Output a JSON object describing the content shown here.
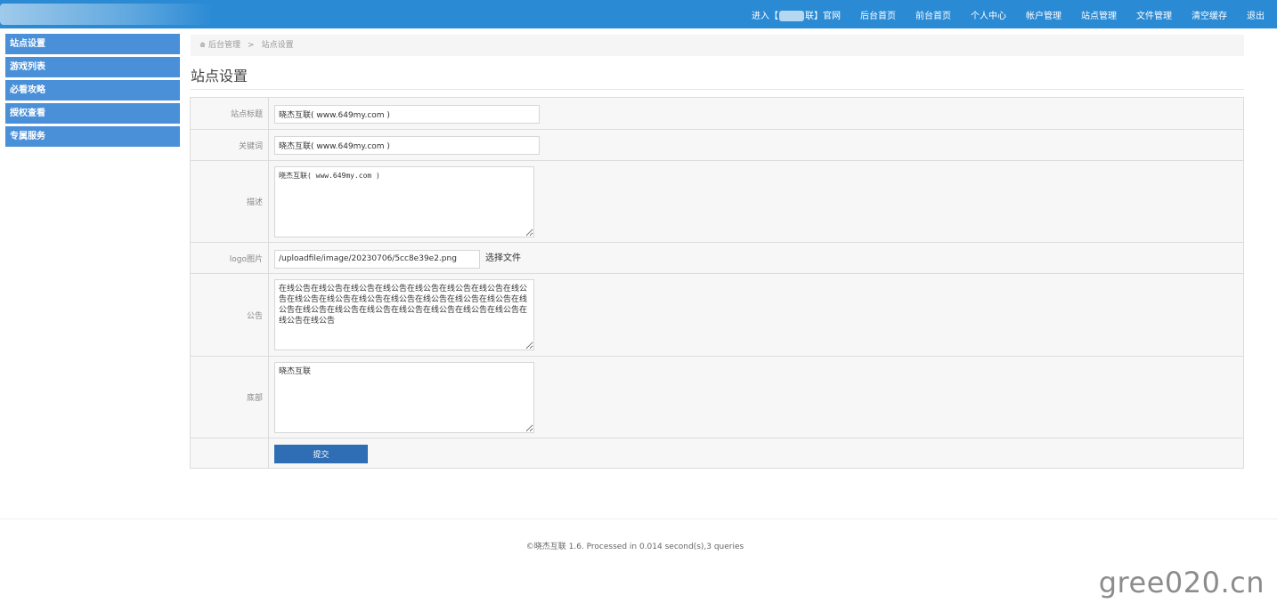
{
  "header": {
    "nav": [
      {
        "label": "进入【",
        "suffix": "联】官网"
      },
      {
        "label": "后台首页"
      },
      {
        "label": "前台首页"
      },
      {
        "label": "个人中心"
      },
      {
        "label": "帐户管理"
      },
      {
        "label": "站点管理"
      },
      {
        "label": "文件管理"
      },
      {
        "label": "清空缓存"
      },
      {
        "label": "退出"
      }
    ]
  },
  "sidebar": {
    "items": [
      {
        "label": "站点设置"
      },
      {
        "label": "游戏列表"
      },
      {
        "label": "必看攻略"
      },
      {
        "label": "授权查看"
      },
      {
        "label": "专属服务"
      }
    ]
  },
  "breadcrumb": {
    "root": "后台管理",
    "separator": ">",
    "current": "站点设置"
  },
  "page": {
    "title": "站点设置"
  },
  "form": {
    "site_title": {
      "label": "站点标题",
      "value": "晓杰互联( www.649my.com )"
    },
    "keywords": {
      "label": "关键词",
      "value": "晓杰互联( www.649my.com )"
    },
    "description": {
      "label": "描述",
      "value": "晓杰互联( www.649my.com )"
    },
    "logo": {
      "label": "logo图片",
      "value": "/uploadfile/image/20230706/5cc8e39e2.png",
      "button": "选择文件"
    },
    "notice": {
      "label": "公告",
      "value": "在线公告在线公告在线公告在线公告在线公告在线公告在线公告在线公告在线公告在线公告在线公告在线公告在线公告在线公告在线公告在线公告在线公告在线公告在线公告在线公告在线公告在线公告在线公告在线公告在线公告"
    },
    "footer": {
      "label": "底部",
      "value": "晓杰互联"
    },
    "submit": "提交"
  },
  "footer": {
    "text": "©晓杰互联 1.6. Processed in 0.014 second(s),3 queries"
  },
  "watermark": "gree020.cn"
}
